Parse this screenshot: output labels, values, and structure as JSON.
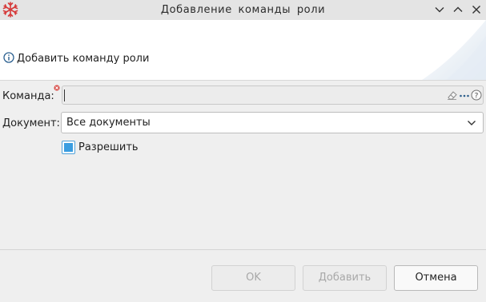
{
  "window": {
    "title": "Добавление  команды  роли"
  },
  "header": {
    "message": "Добавить команду роли",
    "icon": "info-icon"
  },
  "form": {
    "command_label": "Команда:",
    "command_value": "",
    "document_label": "Документ:",
    "document_value": "Все документы",
    "allow_label": "Разрешить",
    "allow_checked": true
  },
  "buttons": {
    "ok": "OK",
    "add": "Добавить",
    "cancel": "Отмена"
  },
  "colors": {
    "checkbox_accent": "#3a9de0",
    "required_mark": "#d9534f",
    "info_icon": "#2a5f8f"
  }
}
